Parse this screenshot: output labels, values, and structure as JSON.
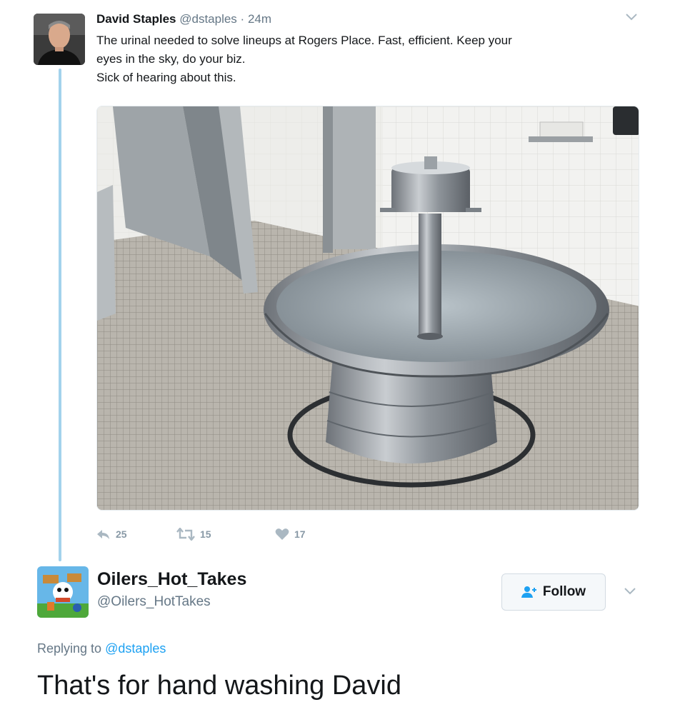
{
  "tweet": {
    "author_name": "David Staples",
    "author_handle": "@dstaples",
    "separator": "·",
    "time": "24m",
    "text_lines": [
      "The urinal needed to solve lineups at Rogers Place. Fast, efficient. Keep your",
      "eyes in the sky, do your biz.",
      "Sick of hearing about this."
    ],
    "media_icon": "photo-washroom-fountain-sink",
    "actions": {
      "reply_count": "25",
      "retweet_count": "15",
      "like_count": "17"
    }
  },
  "reply": {
    "author_name": "Oilers_Hot_Takes",
    "author_handle": "@Oilers_HotTakes",
    "follow_label": "Follow",
    "replying_prefix": "Replying to",
    "replying_to": "@dstaples",
    "text": "That's for hand washing David"
  },
  "colors": {
    "accent": "#1da1f2",
    "thread_line": "#a3d2ec",
    "muted": "#657786",
    "action_gray": "#8899a6"
  }
}
